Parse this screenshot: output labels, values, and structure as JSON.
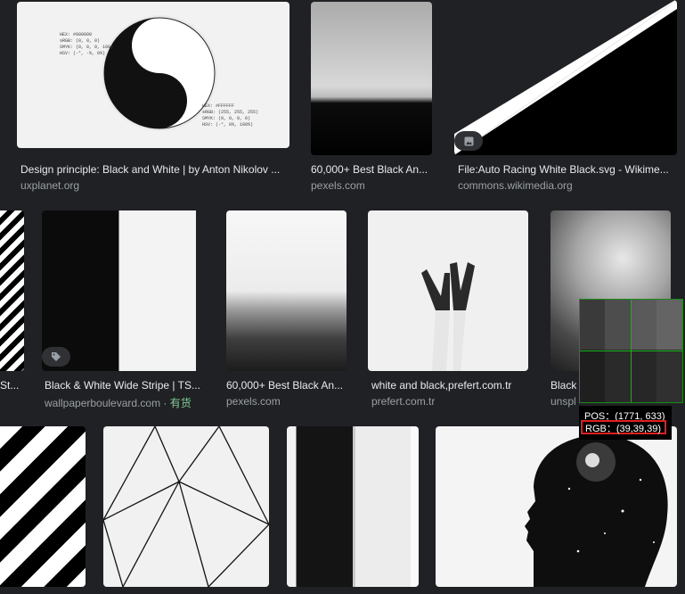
{
  "results": [
    {
      "title": "Design principle: Black and White | by Anton Nikolov ...",
      "source": "uxplanet.org"
    },
    {
      "title": "60,000+ Best Black An...",
      "source": "pexels.com"
    },
    {
      "title": "File:Auto Racing White Black.svg - Wikime...",
      "source": "commons.wikimedia.org"
    },
    {
      "title": "St...",
      "source": ""
    },
    {
      "title": "Black & White Wide Stripe | TS...",
      "source": "wallpaperboulevard.com",
      "availability": "· 有货"
    },
    {
      "title": "60,000+ Best Black An...",
      "source": "pexels.com"
    },
    {
      "title": "white and black,prefert.com.tr",
      "source": "prefert.com.tr"
    },
    {
      "title": "Black",
      "source": "unspl"
    }
  ],
  "yinyang_note": {
    "black": [
      "HEX: #000000",
      "sRGB: (0, 0, 0)",
      "SMYK: (0, 0, 0, 100)",
      "HSV: (-°, -%, 0%)"
    ],
    "white": [
      "HEX: #FFFFFF",
      "sRGB: (255, 255, 255)",
      "SMYK: (0, 0, 0, 0)",
      "HSV: (-°, 0%, 100%)"
    ]
  },
  "picker": {
    "pos": "POS：(1771, 633)",
    "rgb": "RGB：(39,39,39)"
  },
  "icons": [
    "image-icon",
    "tag-icon"
  ]
}
